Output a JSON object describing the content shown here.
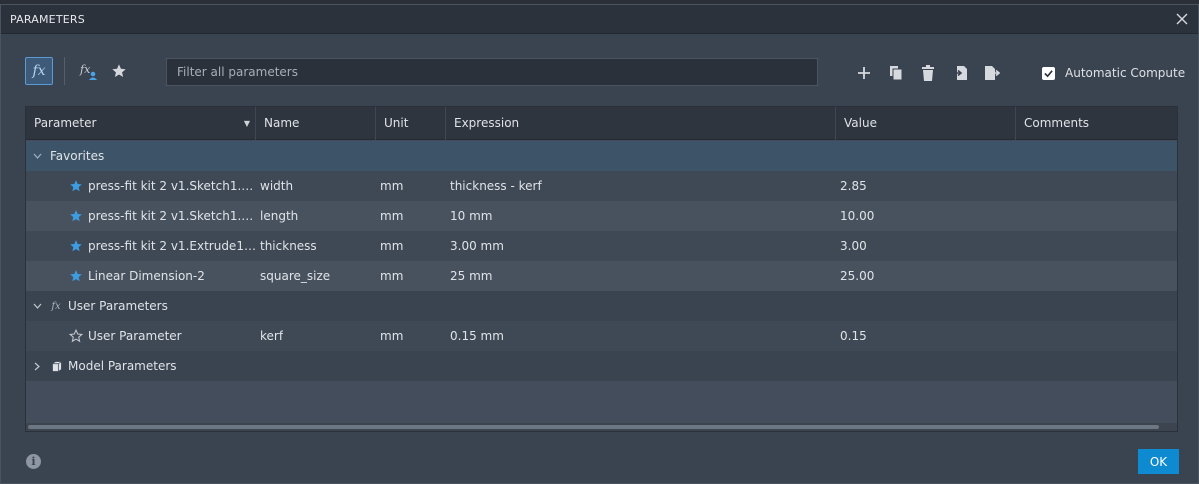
{
  "dialog": {
    "title": "PARAMETERS",
    "ok_label": "OK"
  },
  "toolbar": {
    "fx_label": "fx",
    "filter_placeholder": "Filter all parameters",
    "auto_compute_label": "Automatic Compute",
    "auto_compute_checked": true,
    "actions": [
      "add-icon",
      "copy-icon",
      "delete-icon",
      "import-icon",
      "export-icon"
    ]
  },
  "table": {
    "columns": [
      "Parameter",
      "Name",
      "Unit",
      "Expression",
      "Value",
      "Comments"
    ],
    "groups": {
      "favorites": "Favorites",
      "user": "User Parameters",
      "model": "Model Parameters"
    },
    "favorites": [
      {
        "parameter": "press-fit kit 2 v1.Sketch1.Lin...",
        "name": "width",
        "unit": "mm",
        "expression": "thickness - kerf",
        "value": "2.85",
        "comments": ""
      },
      {
        "parameter": "press-fit kit 2 v1.Sketch1.Lin...",
        "name": "length",
        "unit": "mm",
        "expression": "10 mm",
        "value": "10.00",
        "comments": ""
      },
      {
        "parameter": "press-fit kit 2 v1.Extrude1.Al...",
        "name": "thickness",
        "unit": "mm",
        "expression": "3.00 mm",
        "value": "3.00",
        "comments": ""
      },
      {
        "parameter": "Linear Dimension-2",
        "name": "square_size",
        "unit": "mm",
        "expression": "25 mm",
        "value": "25.00",
        "comments": ""
      }
    ],
    "user": [
      {
        "parameter": "User Parameter",
        "name": "kerf",
        "unit": "mm",
        "expression": "0.15 mm",
        "value": "0.15",
        "comments": ""
      }
    ]
  },
  "colors": {
    "accent": "#0e8ad0",
    "star": "#3d9be0",
    "dialog_bg": "#3a4350"
  }
}
